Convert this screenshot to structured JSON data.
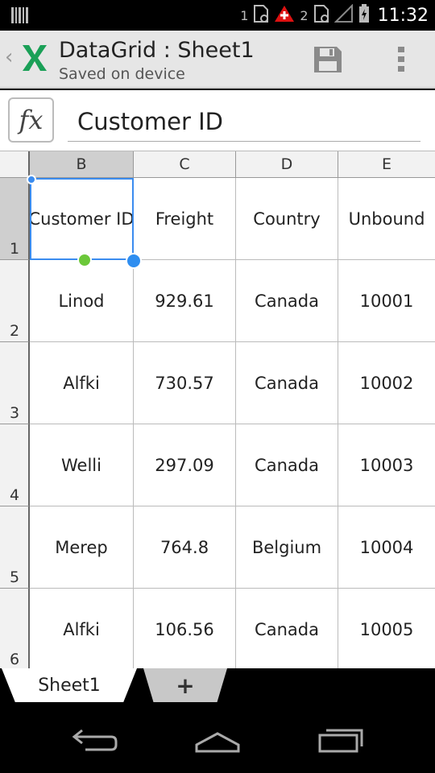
{
  "status_bar": {
    "sim1": "1",
    "sim2": "2",
    "time": "11:32"
  },
  "app": {
    "title": "DataGrid : Sheet1",
    "subtitle": "Saved on device",
    "logo_color": "#1aa057"
  },
  "formula_bar": {
    "fx_label": "fx",
    "value": "Customer ID"
  },
  "grid": {
    "columns": [
      "B",
      "C",
      "D",
      "E"
    ],
    "rows": [
      {
        "num": "1",
        "cells": [
          "Customer ID",
          "Freight",
          "Country",
          "Unbound"
        ]
      },
      {
        "num": "2",
        "cells": [
          "Linod",
          "929.61",
          "Canada",
          "10001"
        ]
      },
      {
        "num": "3",
        "cells": [
          "Alfki",
          "730.57",
          "Canada",
          "10002"
        ]
      },
      {
        "num": "4",
        "cells": [
          "Welli",
          "297.09",
          "Canada",
          "10003"
        ]
      },
      {
        "num": "5",
        "cells": [
          "Merep",
          "764.8",
          "Belgium",
          "10004"
        ]
      },
      {
        "num": "6",
        "cells": [
          "Alfki",
          "106.56",
          "Canada",
          "10005"
        ]
      }
    ],
    "selected_cell": "B1",
    "selection_color": "#3b8cef"
  },
  "sheet_tabs": {
    "active": "Sheet1",
    "add_label": "+"
  }
}
